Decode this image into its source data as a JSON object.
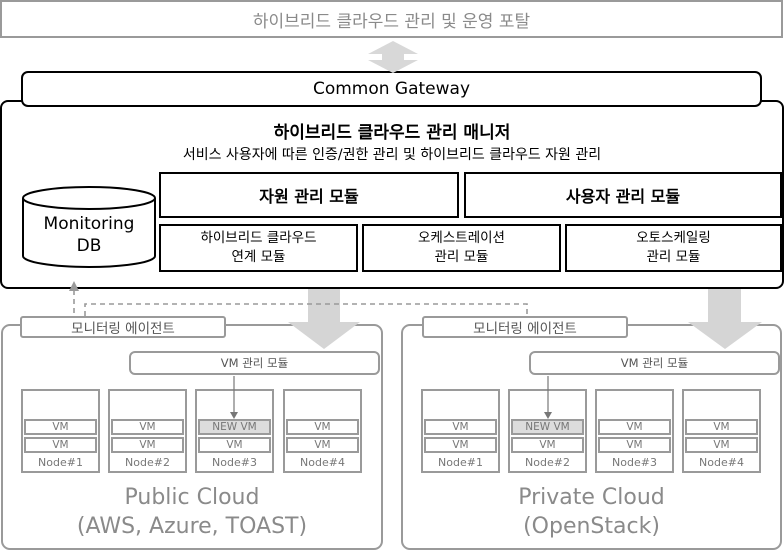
{
  "portal": {
    "label": "하이브리드 클라우드 관리 및 운영 포탈"
  },
  "gateway": {
    "label": "Common Gateway"
  },
  "manager": {
    "title": "하이브리드 클라우드 관리 매니저",
    "subtitle": "서비스 사용자에 따른 인증/권한 관리 및 하이브리드 클라우드 자원 관리",
    "db": {
      "line1": "Monitoring",
      "line2": "DB"
    },
    "modules_top": [
      {
        "label": "자원 관리 모듈"
      },
      {
        "label": "사용자 관리 모듈"
      }
    ],
    "modules_bottom": [
      {
        "line1": "하이브리드 클라우드",
        "line2": "연계 모듈"
      },
      {
        "line1": "오케스트레이션",
        "line2": "관리 모듈"
      },
      {
        "line1": "오토스케일링",
        "line2": "관리 모듈"
      }
    ]
  },
  "clouds": [
    {
      "agent": "모니터링 에이전트",
      "vm_manager": "VM 관리 모듈",
      "name_line1": "Public Cloud",
      "name_line2": "(AWS, Azure, TOAST)",
      "nodes": [
        {
          "label": "Node#1",
          "vms": [
            "VM",
            "VM"
          ]
        },
        {
          "label": "Node#2",
          "vms": [
            "VM",
            "VM"
          ]
        },
        {
          "label": "Node#3",
          "vms": [
            "NEW VM",
            "VM"
          ]
        },
        {
          "label": "Node#4",
          "vms": [
            "VM",
            "VM"
          ]
        }
      ]
    },
    {
      "agent": "모니터링 에이전트",
      "vm_manager": "VM 관리 모듈",
      "name_line1": "Private Cloud",
      "name_line2": "(OpenStack)",
      "nodes": [
        {
          "label": "Node#1",
          "vms": [
            "VM",
            "VM"
          ]
        },
        {
          "label": "Node#2",
          "vms": [
            "NEW VM",
            "VM"
          ]
        },
        {
          "label": "Node#3",
          "vms": [
            "VM",
            "VM"
          ]
        },
        {
          "label": "Node#4",
          "vms": [
            "VM",
            "VM"
          ]
        }
      ]
    }
  ]
}
